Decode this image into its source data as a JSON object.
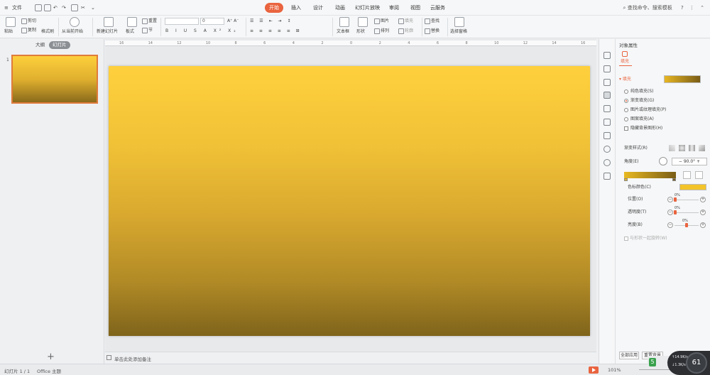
{
  "titlebar": {
    "menu_label": "文件",
    "tabs": [
      {
        "label": "开始",
        "active": true
      },
      {
        "label": "插入",
        "active": false
      },
      {
        "label": "设计",
        "active": false
      },
      {
        "label": "动画",
        "active": false
      },
      {
        "label": "幻灯片放映",
        "active": false
      },
      {
        "label": "审阅",
        "active": false
      },
      {
        "label": "视图",
        "active": false
      },
      {
        "label": "云服务",
        "active": false
      }
    ],
    "search_placeholder": "查找命令、搜索模板",
    "help_icon": "?"
  },
  "ribbon": {
    "paste": "粘贴",
    "cut": "剪切",
    "copy": "复制",
    "format_painter": "格式刷",
    "from_current": "从当前开始",
    "new_slide": "新建幻灯片",
    "layout": "板式",
    "section": "节",
    "reset": "重置",
    "font_size": "0",
    "textbox": "文本框",
    "shape": "形状",
    "arrange": "排列",
    "picture": "图片",
    "fill": "填充",
    "outline": "轮廓",
    "find": "查找",
    "replace": "替换",
    "select_pane": "选择窗格"
  },
  "left_panel": {
    "tab_outline": "大纲",
    "tab_slides": "幻灯片",
    "slide_number": "1",
    "add_button": "+"
  },
  "ruler": {
    "labels": [
      "16",
      "14",
      "12",
      "10",
      "8",
      "6",
      "4",
      "2",
      "0",
      "2",
      "4",
      "6",
      "8",
      "10",
      "12",
      "14",
      "16"
    ]
  },
  "notes": {
    "placeholder": "单击此处添加备注"
  },
  "props": {
    "title": "对象属性",
    "tab_fill": "填充",
    "fill_section": "填充",
    "options": [
      {
        "label": "纯色填充(S)",
        "selected": false
      },
      {
        "label": "渐变填充(G)",
        "selected": true
      },
      {
        "label": "图片或纹理填充(P)",
        "selected": false
      },
      {
        "label": "图案填充(A)",
        "selected": false
      }
    ],
    "hide_bg": "隐藏背景图形(H)",
    "gradient_style": "渐变样式(R)",
    "angle_label": "角度(E)",
    "angle_value": "90.0°",
    "stop_color": "色标颜色(C)",
    "position_label": "位置(O)",
    "position_value": "0%",
    "transparency_label": "透明度(T)",
    "transparency_value": "0%",
    "brightness_label": "亮度(B)",
    "brightness_value": "0%",
    "rotate_with_shape": "与形状一起旋转(W)",
    "apply_all": "全部应用",
    "reset_bg": "重置背景"
  },
  "statusbar": {
    "slide_info": "幻灯片 1 / 1",
    "theme": "Office 主题",
    "zoom": "101%"
  },
  "overlay": {
    "net_up": "↑14.9K/s",
    "net_down": "↓1.3K/s",
    "net_value": "61"
  },
  "colors": {
    "accent": "#e9643f",
    "gradient_top": "#ffd03d",
    "gradient_bottom": "#7f641b"
  }
}
